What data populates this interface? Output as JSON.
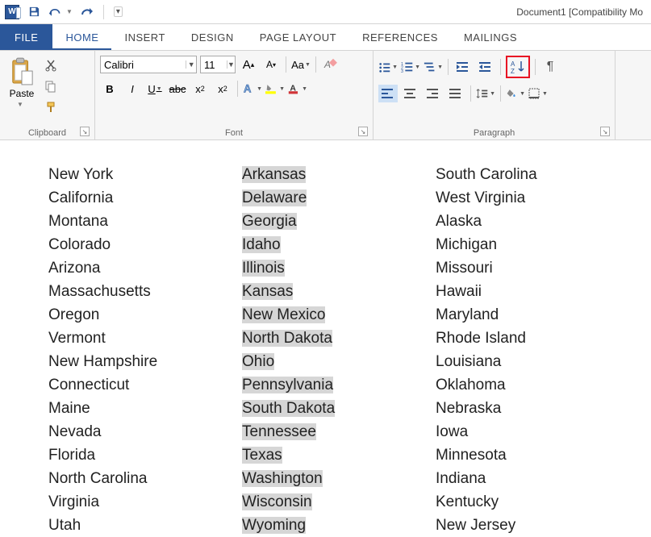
{
  "titlebar": {
    "app_icon_letter": "W",
    "doc_title": "Document1 [Compatibility Mo"
  },
  "tabs": {
    "file": "FILE",
    "home": "HOME",
    "insert": "INSERT",
    "design": "DESIGN",
    "page_layout": "PAGE LAYOUT",
    "references": "REFERENCES",
    "mailings": "MAILINGS"
  },
  "ribbon": {
    "clipboard": {
      "paste": "Paste",
      "label": "Clipboard"
    },
    "font": {
      "name": "Calibri",
      "size": "11",
      "bold": "B",
      "italic": "I",
      "underline": "U",
      "case": "Aa",
      "label": "Font"
    },
    "paragraph": {
      "label": "Paragraph"
    }
  },
  "columns": {
    "c1": [
      "New York",
      "California",
      "Montana",
      "Colorado",
      "Arizona",
      "Massachusetts",
      "Oregon",
      "Vermont",
      "New Hampshire",
      "Connecticut",
      "Maine",
      "Nevada",
      "Florida",
      "North Carolina",
      "Virginia",
      "Utah"
    ],
    "c2": [
      "Arkansas",
      "Delaware",
      "Georgia",
      "Idaho",
      "Illinois",
      "Kansas",
      "New Mexico",
      "North Dakota",
      "Ohio",
      "Pennsylvania",
      "South Dakota",
      "Tennessee",
      "Texas",
      "Washington",
      "Wisconsin",
      "Wyoming"
    ],
    "c3": [
      "South Carolina",
      "West Virginia",
      "Alaska",
      "Michigan",
      "Missouri",
      "Hawaii",
      "Maryland",
      "Rhode Island",
      "Louisiana",
      "Oklahoma",
      "Nebraska",
      "Iowa",
      "Minnesota",
      "Indiana",
      "Kentucky",
      "New Jersey"
    ]
  }
}
